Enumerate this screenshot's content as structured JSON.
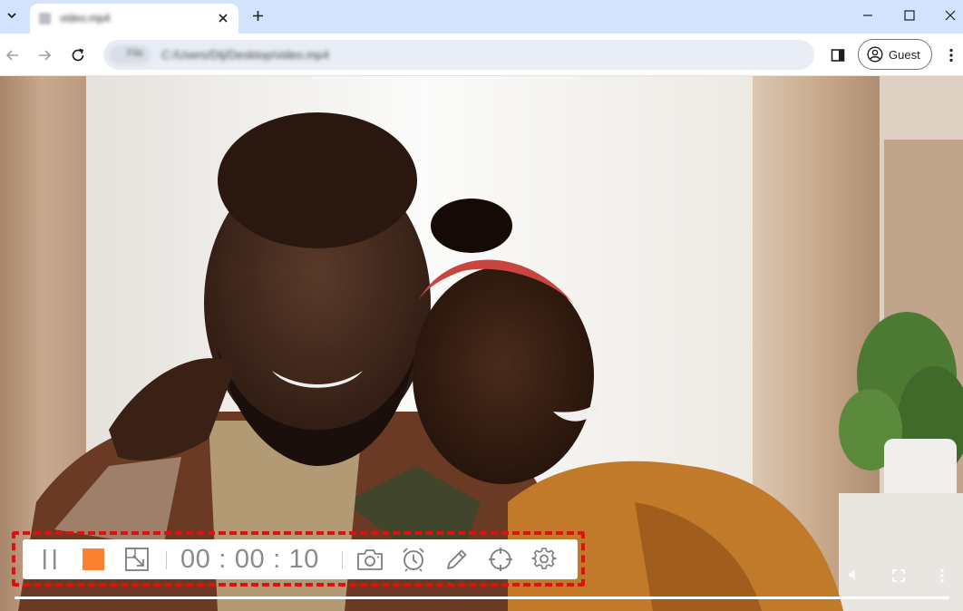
{
  "browser": {
    "tab": {
      "title": "video.mp4"
    },
    "address": {
      "chip": "File",
      "url": "C:/Users/Dtj/Desktop/video.mp4"
    },
    "profile": {
      "label": "Guest"
    }
  },
  "icons": {
    "tab_search": "chevron-down-icon",
    "tab_close": "close-icon",
    "new_tab": "plus-icon",
    "minimize": "minimize-icon",
    "maximize": "maximize-icon",
    "close_window": "close-icon",
    "back": "arrow-left-icon",
    "forward": "arrow-right-icon",
    "reload": "reload-icon",
    "side_panel": "side-panel-icon",
    "avatar": "person-icon",
    "menu": "kebab-menu-icon",
    "recorder": [
      "pause-icon",
      "stop-icon",
      "resize-region-icon",
      "camera-icon",
      "alarm-clock-icon",
      "pencil-icon",
      "crosshair-icon",
      "gear-icon"
    ]
  },
  "recorder": {
    "timer": {
      "hours": "00",
      "minutes": "00",
      "seconds": "10",
      "separator": ":"
    },
    "stop_color": "#fa8231",
    "selection_color": "#e01010"
  },
  "colors": {
    "tabstrip": "#d3e3fd",
    "omnibox": "#e9eef6"
  }
}
